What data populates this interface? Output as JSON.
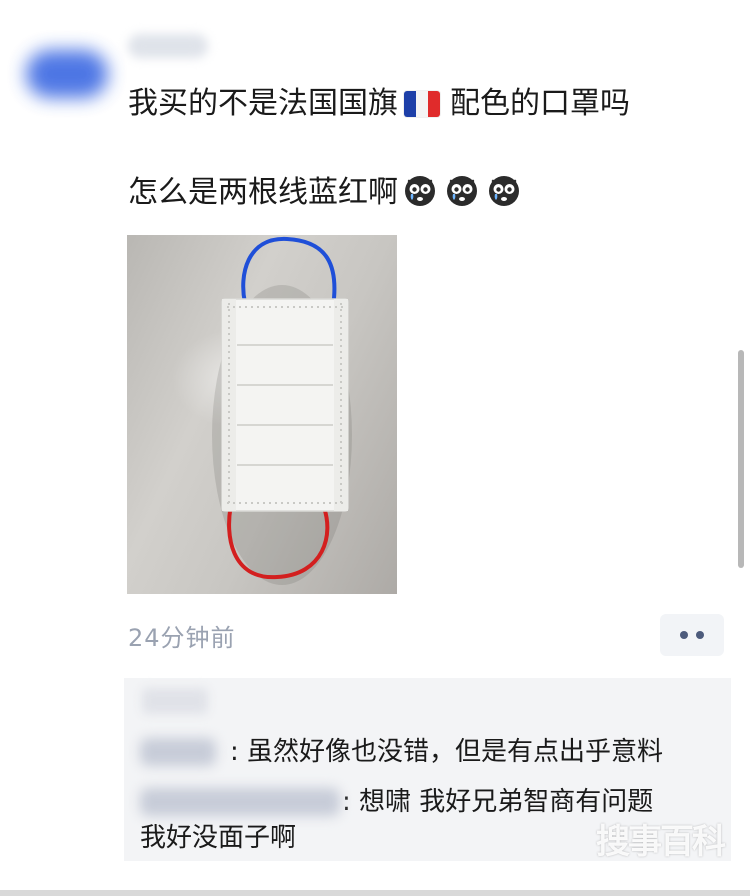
{
  "post": {
    "line1_text": "我买的不是法国国旗",
    "line1_suffix": "配色的口罩吗",
    "line2_text": "怎么是两根线蓝红啊",
    "time": "24分钟前"
  },
  "icons": {
    "flag": "france-flag-emoji",
    "emoji": "crying-face-emoji",
    "more": "more-dots-icon"
  },
  "colors": {
    "ear_loop_top": "#1f4fd8",
    "ear_loop_bottom": "#d31f1f",
    "time_text": "#9aa2b1",
    "comment_bg": "#f3f4f6",
    "more_dots": "#4d5b7c"
  },
  "comments": [
    {
      "text": ": 虽然好像也没错，但是有点出乎意料"
    },
    {
      "text": ": 想啸 我好兄弟智商有问题"
    }
  ],
  "comment_continuation": "我好没面子啊",
  "watermark": "搜事百科"
}
